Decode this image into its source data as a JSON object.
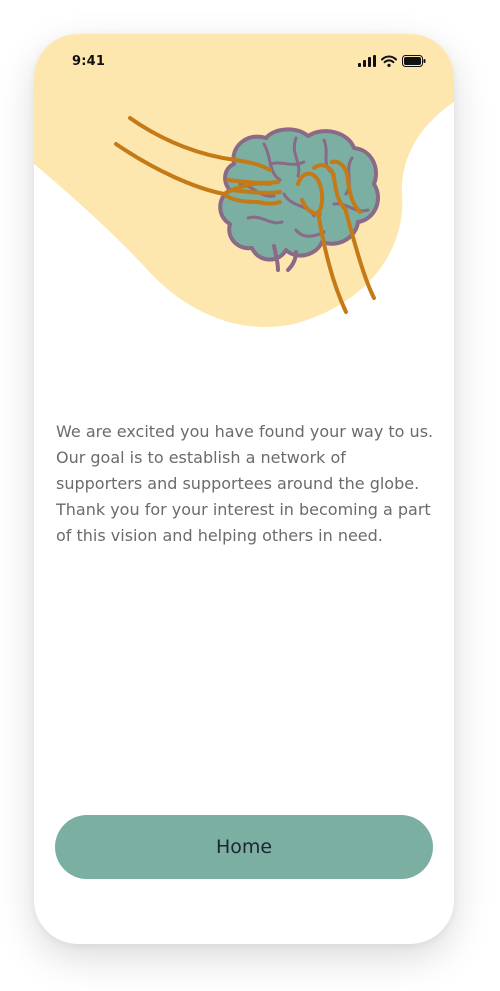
{
  "status_bar": {
    "time": "9:41",
    "icons": [
      "signal-icon",
      "wifi-icon",
      "battery-icon"
    ]
  },
  "hero": {
    "illustration": "hands-holding-brain-illustration"
  },
  "content": {
    "intro": "We are excited you have found your way to us. Our goal is to establish a network of supporters and supportees around the globe. Thank you for your interest in becoming a part of this vision and helping others in need."
  },
  "actions": {
    "home_label": "Home"
  },
  "colors": {
    "hero_background": "#fde7ae",
    "brain_fill": "#7aafa1",
    "brain_outline": "#8a6a86",
    "hand_line": "#c57a18",
    "button_background": "#7aafa1",
    "button_text": "#1f2433",
    "body_text": "#6b6b6b"
  }
}
